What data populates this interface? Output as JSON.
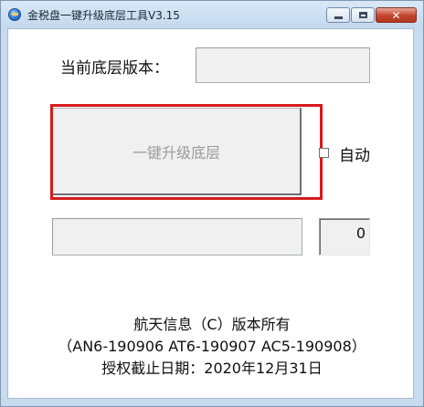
{
  "window": {
    "title": "金税盘一键升级底层工具V3.15"
  },
  "form": {
    "version_label": "当前底层版本：",
    "version_value": "",
    "upgrade_button": "一键升级底层",
    "auto_label": "自动",
    "auto_checked": false,
    "progress_value": "",
    "counter_value": "0"
  },
  "footer": {
    "copyright": "航天信息（C）版本所有",
    "versions": "（AN6-190906  AT6-190907  AC5-190908）",
    "expiry": "授权截止日期：2020年12月31日"
  },
  "colors": {
    "highlight": "#d7191c",
    "disabled_text": "#9a9a9a"
  }
}
